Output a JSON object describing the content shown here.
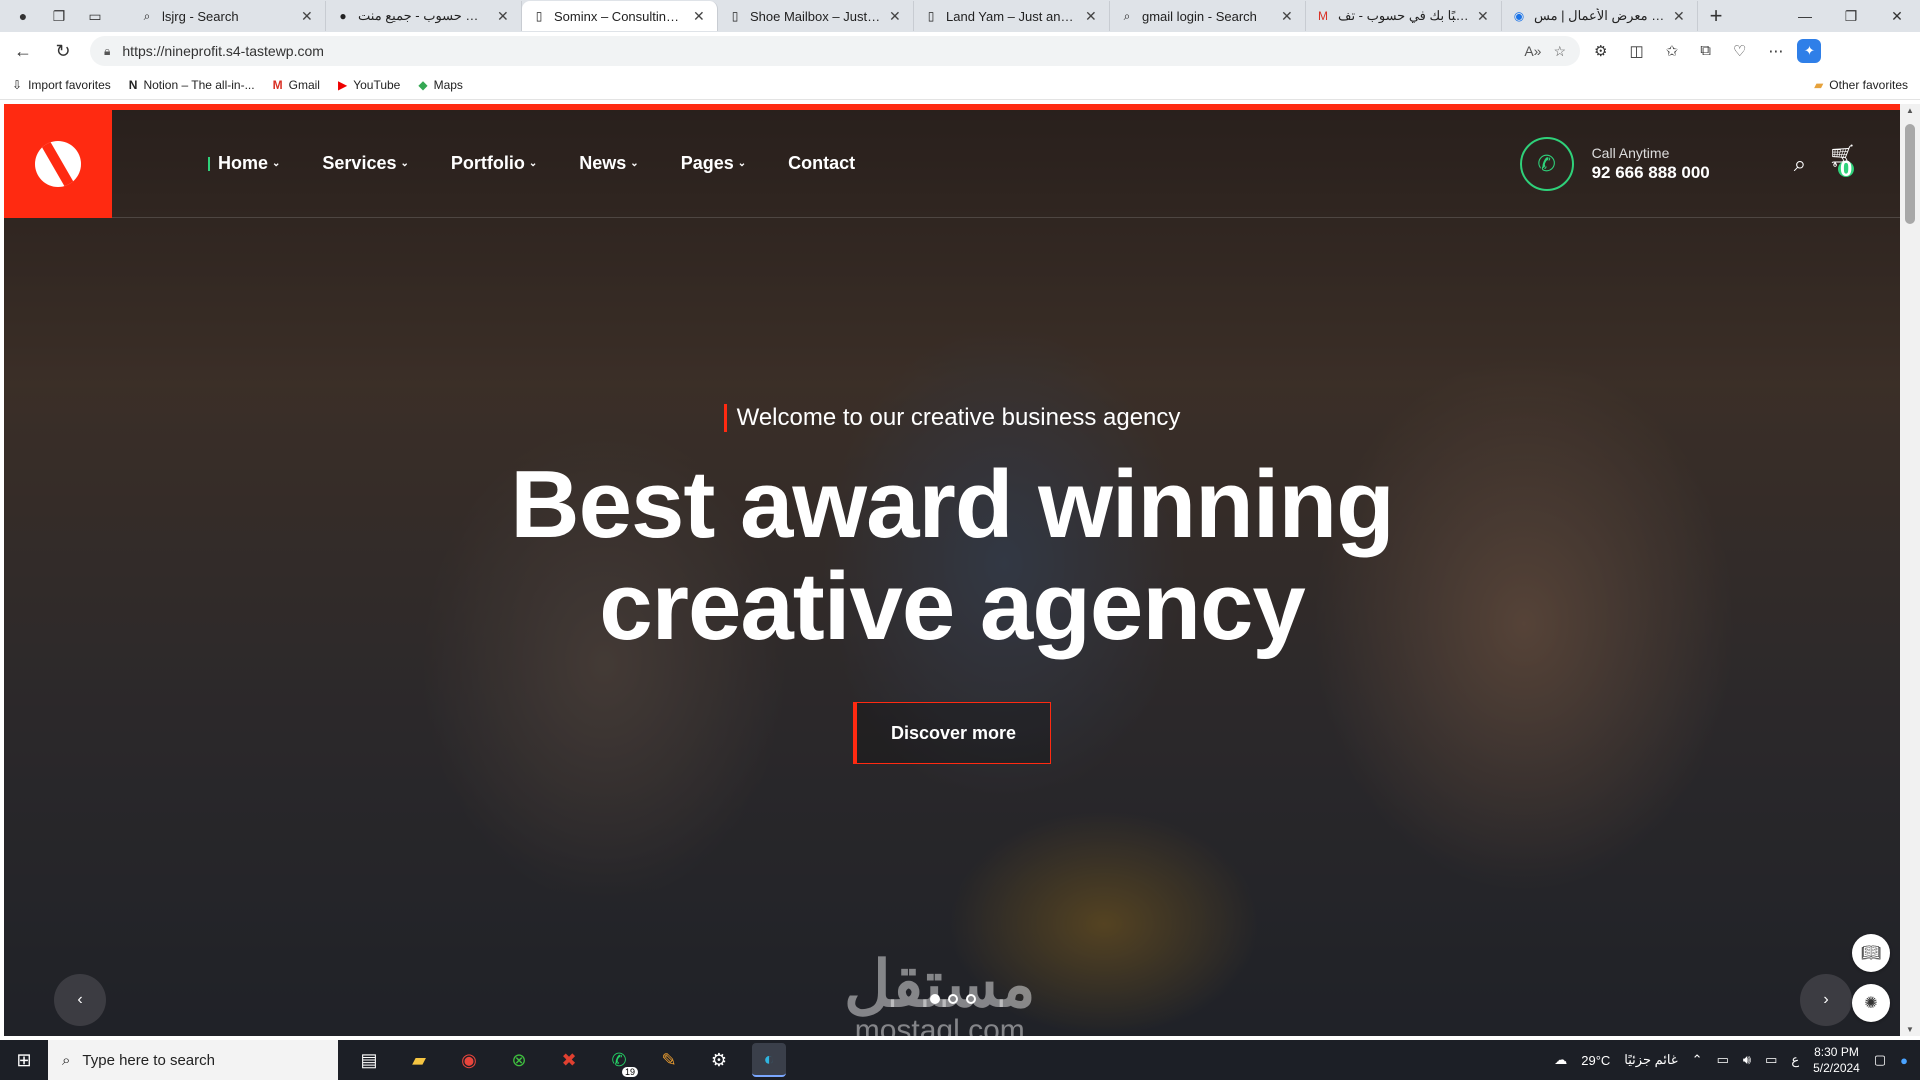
{
  "browser": {
    "tabs": [
      {
        "title": "lsjrg - Search",
        "icon": "search-icon"
      },
      {
        "title": "حسابات حسوب - جميع منت",
        "icon": "globe-icon"
      },
      {
        "title": "Sominx – Consulting Bus",
        "icon": "page-icon",
        "active": true
      },
      {
        "title": "Shoe Mailbox – Just anot",
        "icon": "page-icon"
      },
      {
        "title": "Land Yam – Just another",
        "icon": "page-icon"
      },
      {
        "title": "gmail login - Search",
        "icon": "search-icon"
      },
      {
        "title": "مرحبًا بك في حسوب - تف",
        "icon": "gmail-icon"
      },
      {
        "title": "إضافة معرض الأعمال | مس",
        "icon": "globe-icon"
      }
    ],
    "url": "https://nineprofit.s4-tastewp.com",
    "favorites": [
      {
        "label": "Import favorites",
        "icon": "import-icon"
      },
      {
        "label": "Notion – The all-in-...",
        "icon": "notion-icon"
      },
      {
        "label": "Gmail",
        "icon": "gmail-icon"
      },
      {
        "label": "YouTube",
        "icon": "youtube-icon"
      },
      {
        "label": "Maps",
        "icon": "maps-icon"
      }
    ],
    "other_favorites": "Other favorites"
  },
  "site": {
    "menu": [
      {
        "label": "Home",
        "dropdown": true,
        "current": true
      },
      {
        "label": "Services",
        "dropdown": true
      },
      {
        "label": "Portfolio",
        "dropdown": true
      },
      {
        "label": "News",
        "dropdown": true
      },
      {
        "label": "Pages",
        "dropdown": true
      },
      {
        "label": "Contact",
        "dropdown": false
      }
    ],
    "call_label": "Call Anytime",
    "call_number": "92 666 888 000",
    "cart_count": "0",
    "tagline": "Welcome to our creative business agency",
    "headline_line1": "Best award winning",
    "headline_line2": "creative agency",
    "cta_label": "Discover more",
    "slider": {
      "total": 3,
      "active": 1
    },
    "accent_color": "#ff2a11",
    "green_color": "#2fd17a"
  },
  "watermark": {
    "arabic": "مستقل",
    "latin": "mostaql.com"
  },
  "taskbar": {
    "search_placeholder": "Type here to search",
    "weather": "29°C",
    "weather_text": "غائم جزئيًا",
    "lang": "ع",
    "time": "8:30 PM",
    "date": "5/2/2024",
    "whatsapp_badge": "19"
  }
}
